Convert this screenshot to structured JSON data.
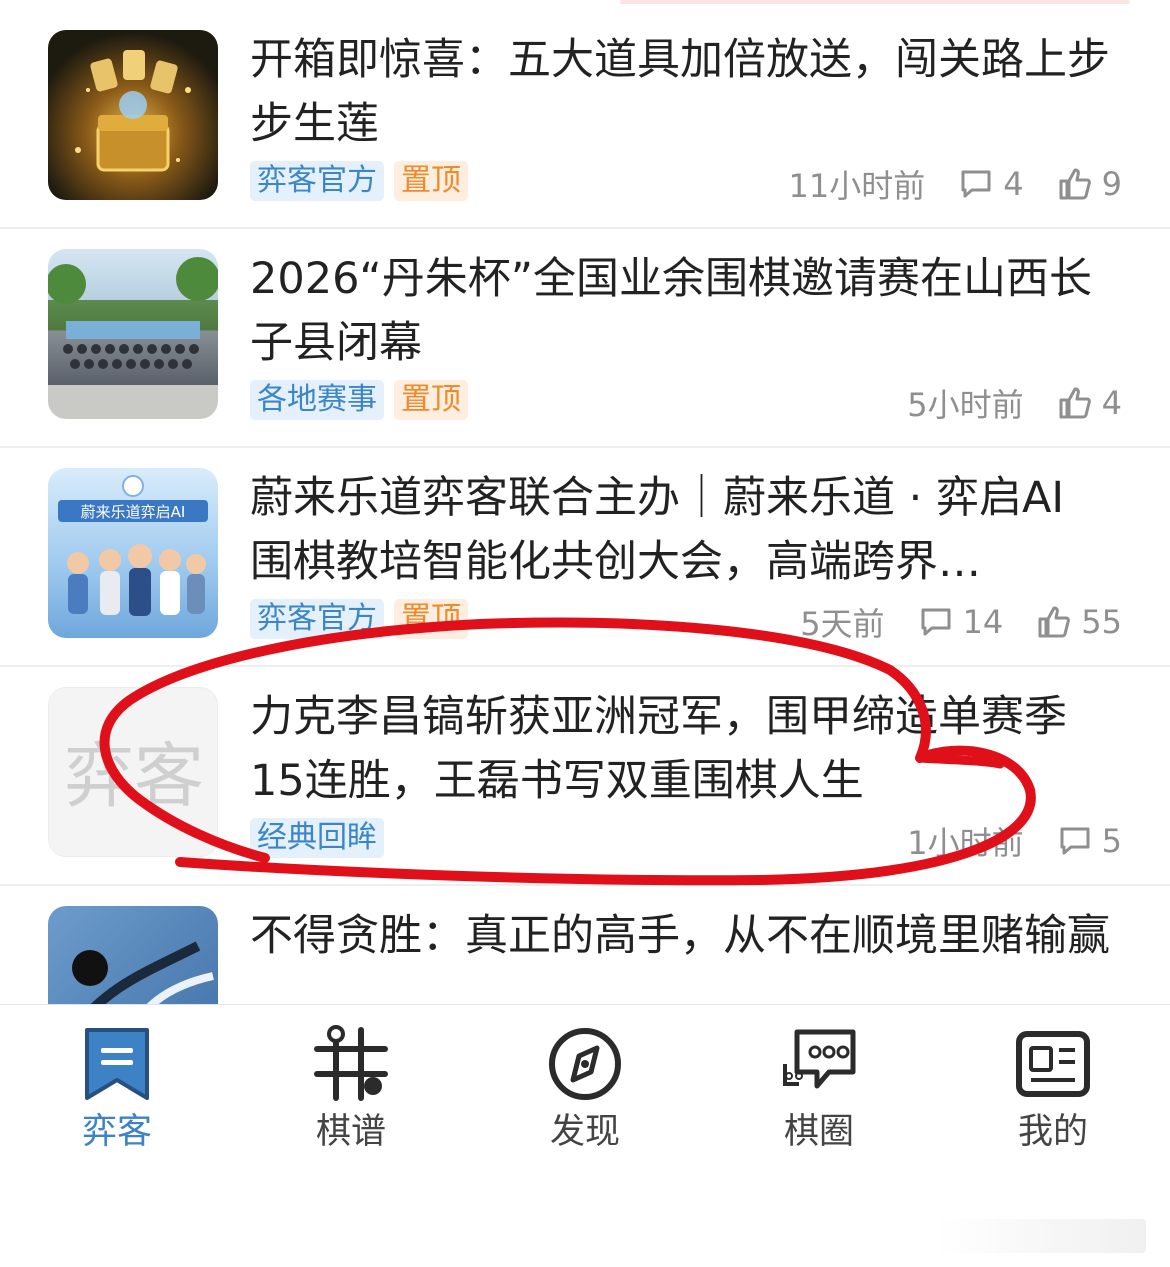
{
  "feed": {
    "items": [
      {
        "title": "开箱即惊喜：五大道具加倍放送，闯关路上步步生莲",
        "tags": [
          "弈客官方",
          "置顶"
        ],
        "time": "11小时前",
        "comments": "4",
        "likes": "9",
        "thumb_icon": "treasure-chest-image"
      },
      {
        "title": "2026“丹朱杯”全国业余围棋邀请赛在山西长子县闭幕",
        "tags": [
          "各地赛事",
          "置顶"
        ],
        "time": "5小时前",
        "likes": "4",
        "thumb_icon": "group-photo-image"
      },
      {
        "title": "蔚来乐道弈客联合主办｜蔚来乐道 · 弈启AI 围棋教培智能化共创大会，高端跨界…",
        "tags": [
          "弈客官方",
          "置顶"
        ],
        "time": "5天前",
        "comments": "14",
        "likes": "55",
        "thumb_icon": "conference-poster-image",
        "thumb_text": "蔚来乐道弈启AI"
      },
      {
        "title": "力克李昌镐斩获亚洲冠军，围甲缔造单赛季15连胜，王磊书写双重围棋人生",
        "tags": [
          "经典回眸"
        ],
        "time": "1小时前",
        "comments": "5",
        "thumb_icon": "yike-placeholder-logo",
        "thumb_text": "弈客"
      },
      {
        "title": "不得贪胜：真正的高手，从不在顺境里赌输赢",
        "thumb_icon": "go-stones-image"
      }
    ]
  },
  "tabbar": {
    "tabs": [
      {
        "label": "弈客",
        "icon": "bookmark-icon",
        "active": true
      },
      {
        "label": "棋谱",
        "icon": "go-board-icon",
        "active": false
      },
      {
        "label": "发现",
        "icon": "compass-icon",
        "active": false
      },
      {
        "label": "棋圈",
        "icon": "chat-bubbles-icon",
        "active": false
      },
      {
        "label": "我的",
        "icon": "profile-card-icon",
        "active": false
      }
    ]
  },
  "colors": {
    "accent": "#3c82c4",
    "tag_blue": "#3c86c8",
    "tag_orange": "#ef8a2b",
    "annotation_red": "#e0101a"
  }
}
